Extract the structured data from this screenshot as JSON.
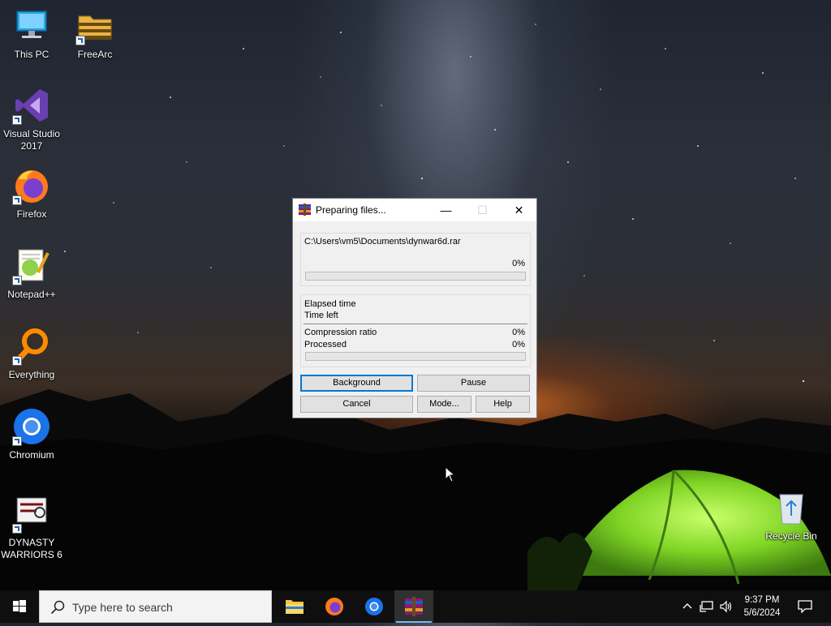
{
  "desktop": {
    "icons": [
      {
        "label_line1": "This PC",
        "label_line2": ""
      },
      {
        "label_line1": "FreeArc",
        "label_line2": ""
      },
      {
        "label_line1": "Visual Studio",
        "label_line2": "2017"
      },
      {
        "label_line1": "Firefox",
        "label_line2": ""
      },
      {
        "label_line1": "Notepad++",
        "label_line2": ""
      },
      {
        "label_line1": "Everything",
        "label_line2": ""
      },
      {
        "label_line1": "Chromium",
        "label_line2": ""
      },
      {
        "label_line1": "DYNASTY",
        "label_line2": "WARRIORS 6"
      },
      {
        "label_line1": "Recycle Bin",
        "label_line2": ""
      }
    ]
  },
  "dialog": {
    "title": "Preparing files...",
    "file_path": "C:\\Users\\vm5\\Documents\\dynwar6d.rar",
    "file_percent": "0%",
    "file_progress": 0,
    "elapsed_label": "Elapsed time",
    "time_left_label": "Time left",
    "compression_label": "Compression ratio",
    "compression_value": "0%",
    "processed_label": "Processed",
    "processed_value": "0%",
    "processed_progress": 0,
    "buttons": {
      "background": "Background",
      "pause": "Pause",
      "cancel": "Cancel",
      "mode": "Mode...",
      "help": "Help"
    }
  },
  "taskbar": {
    "search_placeholder": "Type here to search",
    "apps": [
      "file-explorer-icon",
      "firefox-icon",
      "chromium-icon",
      "winrar-icon"
    ],
    "clock_time": "9:37 PM",
    "clock_date": "5/6/2024"
  },
  "colors": {
    "accent": "#0078d7",
    "tent_green": "#8fe22a",
    "progress_green": "#06b025"
  }
}
